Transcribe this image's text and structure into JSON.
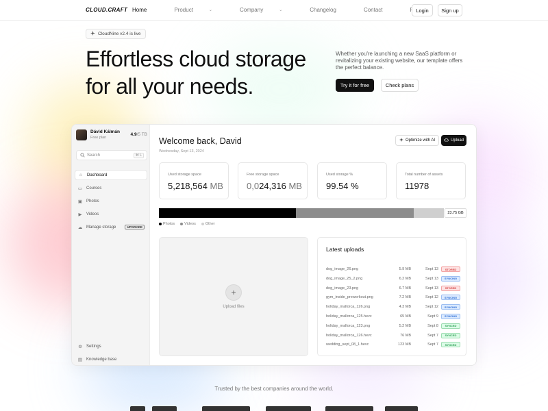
{
  "nav": {
    "logo": "CLOUD.CRAFT",
    "links": [
      {
        "label": "Home",
        "active": true,
        "dropdown": false
      },
      {
        "label": "Product",
        "active": false,
        "dropdown": true
      },
      {
        "label": "Company",
        "active": false,
        "dropdown": true
      },
      {
        "label": "Changelog",
        "active": false,
        "dropdown": false
      },
      {
        "label": "Contact",
        "active": false,
        "dropdown": false
      },
      {
        "label": "Pricing",
        "active": false,
        "dropdown": false
      }
    ],
    "login": "Login",
    "signup": "Sign up"
  },
  "hero": {
    "badge": "CloudNine v2.4 is live",
    "title_line1": "Effortless cloud storage",
    "title_line2": "for all your needs.",
    "subtitle": "Whether you're launching a new SaaS platform or revitalizing your existing website, our template offers the perfect balance.",
    "cta_primary": "Try it for free",
    "cta_secondary": "Check plans"
  },
  "app": {
    "user": {
      "name": "Dávid Kálmán",
      "plan": "Free plan",
      "storage_used": "4.9",
      "storage_total": "/5 TB"
    },
    "search": {
      "placeholder": "Search",
      "shortcut": "⌘ L"
    },
    "sidebar": {
      "items": [
        {
          "label": "Dashboard",
          "icon": "home-icon",
          "active": true
        },
        {
          "label": "Courses",
          "icon": "courses-icon",
          "active": false
        },
        {
          "label": "Photos",
          "icon": "photo-icon",
          "active": false
        },
        {
          "label": "Videos",
          "icon": "video-icon",
          "active": false
        },
        {
          "label": "Manage storage",
          "icon": "cloud-icon",
          "active": false,
          "badge": "UPGRADE"
        }
      ],
      "bottom": [
        {
          "label": "Settings",
          "icon": "gear-icon"
        },
        {
          "label": "Knowledge base",
          "icon": "book-icon"
        }
      ]
    },
    "header": {
      "welcome": "Welcome back, David",
      "date": "Wednesday, Sept 13, 2024",
      "optimize": "Optimize with AI",
      "upload": "Upload"
    },
    "stats": [
      {
        "label": "Used storage space",
        "value": "5,218,564",
        "value_dim": "",
        "unit": "MB"
      },
      {
        "label": "Free storage space",
        "value": "24,316",
        "value_dim": "0,0",
        "unit": "MB"
      },
      {
        "label": "Used storage %",
        "value": "99.54 %",
        "value_dim": "",
        "unit": ""
      },
      {
        "label": "Total number of assets",
        "value": "11978",
        "value_dim": "",
        "unit": ""
      }
    ],
    "storage_bar": {
      "segments": [
        {
          "name": "Photos",
          "fraction": 0.48,
          "color": "#000000"
        },
        {
          "name": "Videos",
          "fraction": 0.415,
          "color": "#8c8c8c"
        },
        {
          "name": "Other",
          "fraction": 0.105,
          "color": "#cfcfcf"
        }
      ],
      "total": "23.75 GB"
    },
    "upload_box": {
      "label": "Upload files"
    },
    "latest_uploads": {
      "title": "Latest uploads",
      "rows": [
        {
          "name": "dog_image_26.png",
          "size": "5.9 MB",
          "date": "Sept 13",
          "status": "STORED"
        },
        {
          "name": "dog_image_25_2.png",
          "size": "6.2 MB",
          "date": "Sept 13",
          "status": "SYNCING"
        },
        {
          "name": "dog_image_23.png",
          "size": "6.7 MB",
          "date": "Sept 13",
          "status": "STORED"
        },
        {
          "name": "gym_inside_preworkout.png",
          "size": "7.2 MB",
          "date": "Sept 12",
          "status": "SYNCING"
        },
        {
          "name": "holiday_mallorca_126.png",
          "size": "4.3 MB",
          "date": "Sept 12",
          "status": "SYNCING"
        },
        {
          "name": "holiday_mallorca_125.hevc",
          "size": "65 MB",
          "date": "Sept 9",
          "status": "SYNCING"
        },
        {
          "name": "holiday_mallorca_123.png",
          "size": "5.2 MB",
          "date": "Sept 8",
          "status": "SYNCED"
        },
        {
          "name": "holiday_mallorca_126.hevc",
          "size": "76 MB",
          "date": "Sept 7",
          "status": "SYNCED"
        },
        {
          "name": "wedding_sept_08_1.hevc",
          "size": "123 MB",
          "date": "Sept 7",
          "status": "SYNCED"
        }
      ]
    }
  },
  "status_colors": {
    "STORED": {
      "bg": "#fde2e2",
      "fg": "#d64545",
      "border": "#f3a3a3"
    },
    "SYNCING": {
      "bg": "#dbeafe",
      "fg": "#2f6fd6",
      "border": "#9dbff2"
    },
    "SYNCED": {
      "bg": "#dcfce7",
      "fg": "#2f9e55",
      "border": "#9bdcb0"
    }
  },
  "footer": {
    "trusted": "Trusted by the best companies around the world."
  }
}
